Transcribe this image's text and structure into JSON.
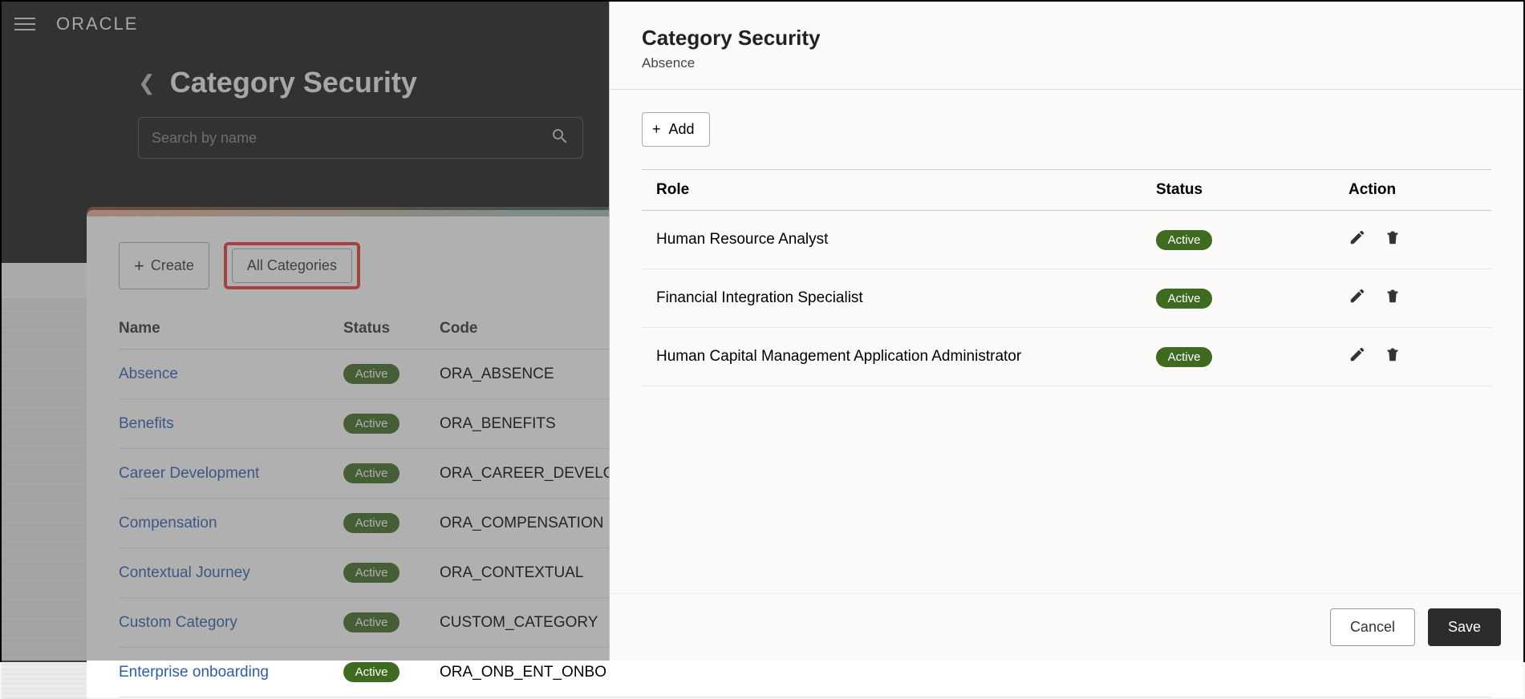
{
  "brand": "ORACLE",
  "page": {
    "title": "Category Security",
    "search_placeholder": "Search by name"
  },
  "toolbar": {
    "create_label": "Create",
    "all_categories_label": "All Categories"
  },
  "main_table": {
    "headers": {
      "name": "Name",
      "status": "Status",
      "code": "Code"
    },
    "rows": [
      {
        "name": "Absence",
        "status": "Active",
        "code": "ORA_ABSENCE"
      },
      {
        "name": "Benefits",
        "status": "Active",
        "code": "ORA_BENEFITS"
      },
      {
        "name": "Career Development",
        "status": "Active",
        "code": "ORA_CAREER_DEVELO"
      },
      {
        "name": "Compensation",
        "status": "Active",
        "code": "ORA_COMPENSATION"
      },
      {
        "name": "Contextual Journey",
        "status": "Active",
        "code": "ORA_CONTEXTUAL"
      },
      {
        "name": "Custom Category",
        "status": "Active",
        "code": "CUSTOM_CATEGORY"
      },
      {
        "name": "Enterprise onboarding",
        "status": "Active",
        "code": "ORA_ONB_ENT_ONBO"
      }
    ]
  },
  "drawer": {
    "title": "Category Security",
    "subtitle": "Absence",
    "add_label": "Add",
    "headers": {
      "role": "Role",
      "status": "Status",
      "action": "Action"
    },
    "rows": [
      {
        "role": "Human Resource Analyst",
        "status": "Active"
      },
      {
        "role": "Financial Integration Specialist",
        "status": "Active"
      },
      {
        "role": "Human Capital Management Application Administrator",
        "status": "Active"
      }
    ],
    "cancel_label": "Cancel",
    "save_label": "Save"
  }
}
